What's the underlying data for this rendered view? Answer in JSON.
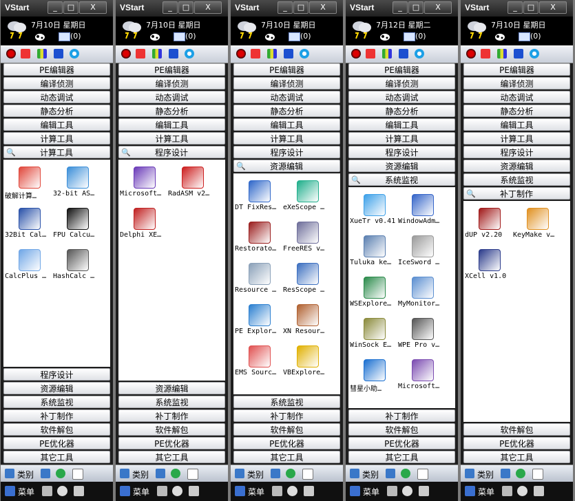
{
  "app_title": "VStart",
  "window_buttons": [
    "_",
    "□",
    "X"
  ],
  "panels": [
    {
      "date": "7月10日 星期日",
      "mail": "(0)",
      "top_categories": [
        "PE编辑器",
        "编译侦测",
        "动态调试",
        "静态分析",
        "编辑工具",
        "计算工具"
      ],
      "active_category": "计算工具",
      "items": [
        {
          "label": "破解计算…",
          "icon": "atom-icon",
          "color": "#e0463a"
        },
        {
          "label": "32-bit AS…",
          "icon": "calculator-icon",
          "color": "#3a8ed8"
        },
        {
          "label": "32Bit Cal…",
          "icon": "grid-icon",
          "color": "#2850a8"
        },
        {
          "label": "FPU Calcu…",
          "icon": "fpu-icon",
          "color": "#111111"
        },
        {
          "label": "CalcPlus …",
          "icon": "calcplus-icon",
          "color": "#6fa6e6"
        },
        {
          "label": "HashCalc …",
          "icon": "hash-icon",
          "color": "#555555"
        }
      ],
      "bottom_categories": [
        "程序设计",
        "资源编辑",
        "系统监视",
        "补丁制作",
        "软件解包",
        "PE优化器",
        "其它工具"
      ]
    },
    {
      "date": "7月10日 星期日",
      "mail": "(0)",
      "top_categories": [
        "PE编辑器",
        "编译侦测",
        "动态调试",
        "静态分析",
        "编辑工具",
        "计算工具"
      ],
      "active_category": "程序设计",
      "items": [
        {
          "label": "Microsoft…",
          "icon": "visual-studio-icon",
          "color": "#6a3ab8"
        },
        {
          "label": "RadASM v2…",
          "icon": "radasm-icon",
          "color": "#cc1e1e"
        },
        {
          "label": "Delphi XE…",
          "icon": "delphi-icon",
          "color": "#c02020"
        }
      ],
      "bottom_categories": [
        "资源编辑",
        "系统监视",
        "补丁制作",
        "软件解包",
        "PE优化器",
        "其它工具"
      ]
    },
    {
      "date": "7月10日 星期日",
      "mail": "(0)",
      "top_categories": [
        "PE编辑器",
        "编译侦测",
        "动态调试",
        "静态分析",
        "编辑工具",
        "计算工具",
        "程序设计"
      ],
      "active_category": "资源编辑",
      "items": [
        {
          "label": "DT FixRes…",
          "icon": "fixres-icon",
          "color": "#2f67c9"
        },
        {
          "label": "eXeScope …",
          "icon": "exescope-icon",
          "color": "#1fae8b"
        },
        {
          "label": "Restorato…",
          "icon": "restorator-icon",
          "color": "#9a1d1d"
        },
        {
          "label": "FreeRES v…",
          "icon": "freeres-icon",
          "color": "#6e6e9a"
        },
        {
          "label": "Resource …",
          "icon": "resource-icon",
          "color": "#8aa0b8"
        },
        {
          "label": "ResScope …",
          "icon": "resscope-icon",
          "color": "#3c6fc0"
        },
        {
          "label": "PE Explor…",
          "icon": "pe-explorer-icon",
          "color": "#2a7fd0"
        },
        {
          "label": "XN Resour…",
          "icon": "xn-resource-icon",
          "color": "#b06030"
        },
        {
          "label": "EMS Sourc…",
          "icon": "ems-icon",
          "color": "#e05050"
        },
        {
          "label": "VBExplore…",
          "icon": "vbexplorer-icon",
          "color": "#e0b000"
        }
      ],
      "bottom_categories": [
        "系统监视",
        "补丁制作",
        "软件解包",
        "PE优化器",
        "其它工具"
      ]
    },
    {
      "date": "7月12日 星期二",
      "mail": "(0)",
      "top_categories": [
        "PE编辑器",
        "编译侦测",
        "动态调试",
        "静态分析",
        "编辑工具",
        "计算工具",
        "程序设计",
        "资源编辑"
      ],
      "active_category": "系统监视",
      "items": [
        {
          "label": "XueTr v0.41",
          "icon": "xuetr-icon",
          "color": "#3ca0e8"
        },
        {
          "label": "WindowAdm…",
          "icon": "window-admin-icon",
          "color": "#3464c8"
        },
        {
          "label": "Tuluka ke…",
          "icon": "tuluka-icon",
          "color": "#5a7fb0"
        },
        {
          "label": "IceSword …",
          "icon": "icesword-icon",
          "color": "#9a9a9a"
        },
        {
          "label": "WSExplore…",
          "icon": "wsexplorer-icon",
          "color": "#2a8a4a"
        },
        {
          "label": "MyMonitor…",
          "icon": "mymonitor-icon",
          "color": "#5a8ed0"
        },
        {
          "label": "WinSock E…",
          "icon": "winsock-icon",
          "color": "#8a8a3a"
        },
        {
          "label": "WPE Pro v…",
          "icon": "wpe-icon",
          "color": "#555555"
        },
        {
          "label": "彗星小助…",
          "icon": "comet-icon",
          "color": "#1a6fd0"
        },
        {
          "label": "Microsoft…",
          "icon": "microsoft-tool-icon",
          "color": "#7a4ab0"
        }
      ],
      "bottom_categories": [
        "补丁制作",
        "软件解包",
        "PE优化器",
        "其它工具"
      ]
    },
    {
      "date": "7月10日 星期日",
      "mail": "(0)",
      "top_categories": [
        "PE编辑器",
        "编译侦测",
        "动态调试",
        "静态分析",
        "编辑工具",
        "计算工具",
        "程序设计",
        "资源编辑",
        "系统监视"
      ],
      "active_category": "补丁制作",
      "items": [
        {
          "label": "dUP v2.20",
          "icon": "dup-icon",
          "color": "#a01818"
        },
        {
          "label": "KeyMake v…",
          "icon": "keymake-icon",
          "color": "#e09020"
        },
        {
          "label": "XCell v1.0",
          "icon": "xcell-icon",
          "color": "#2a3a8a"
        }
      ],
      "bottom_categories": [
        "软件解包",
        "PE优化器",
        "其它工具"
      ]
    }
  ],
  "footer": {
    "category_label": "类别"
  },
  "status": {
    "menu_label": "菜单"
  }
}
